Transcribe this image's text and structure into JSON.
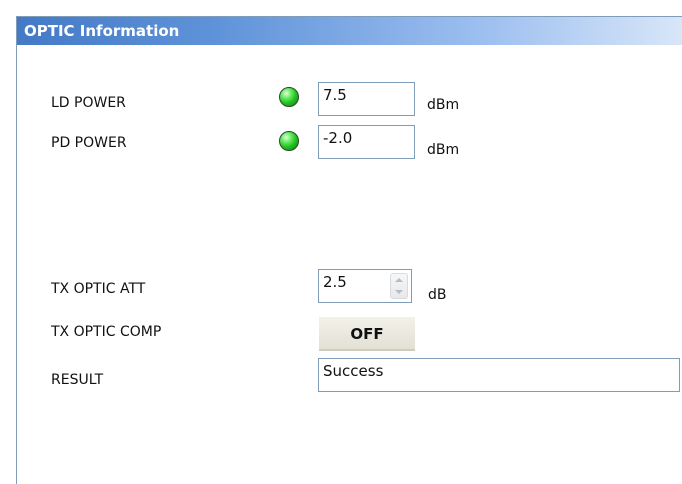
{
  "panel": {
    "title": "OPTIC Information"
  },
  "ld_power": {
    "label": "LD POWER",
    "status": "ok",
    "value": "7.5",
    "unit": "dBm"
  },
  "pd_power": {
    "label": "PD POWER",
    "status": "ok",
    "value": "-2.0",
    "unit": "dBm"
  },
  "tx_optic_att": {
    "label": "TX OPTIC ATT",
    "value": "2.5",
    "unit": "dB"
  },
  "tx_optic_comp": {
    "label": "TX OPTIC COMP",
    "button_label": "OFF"
  },
  "result": {
    "label": "RESULT",
    "value": "Success"
  },
  "colors": {
    "header_start": "#4479c6",
    "header_end": "#d8e6f8",
    "led_on": "#22c422",
    "field_border": "#7f9db9"
  },
  "icons": {
    "status_led": "green-led-icon",
    "spin_up": "spin-up-arrow-icon",
    "spin_down": "spin-down-arrow-icon"
  }
}
